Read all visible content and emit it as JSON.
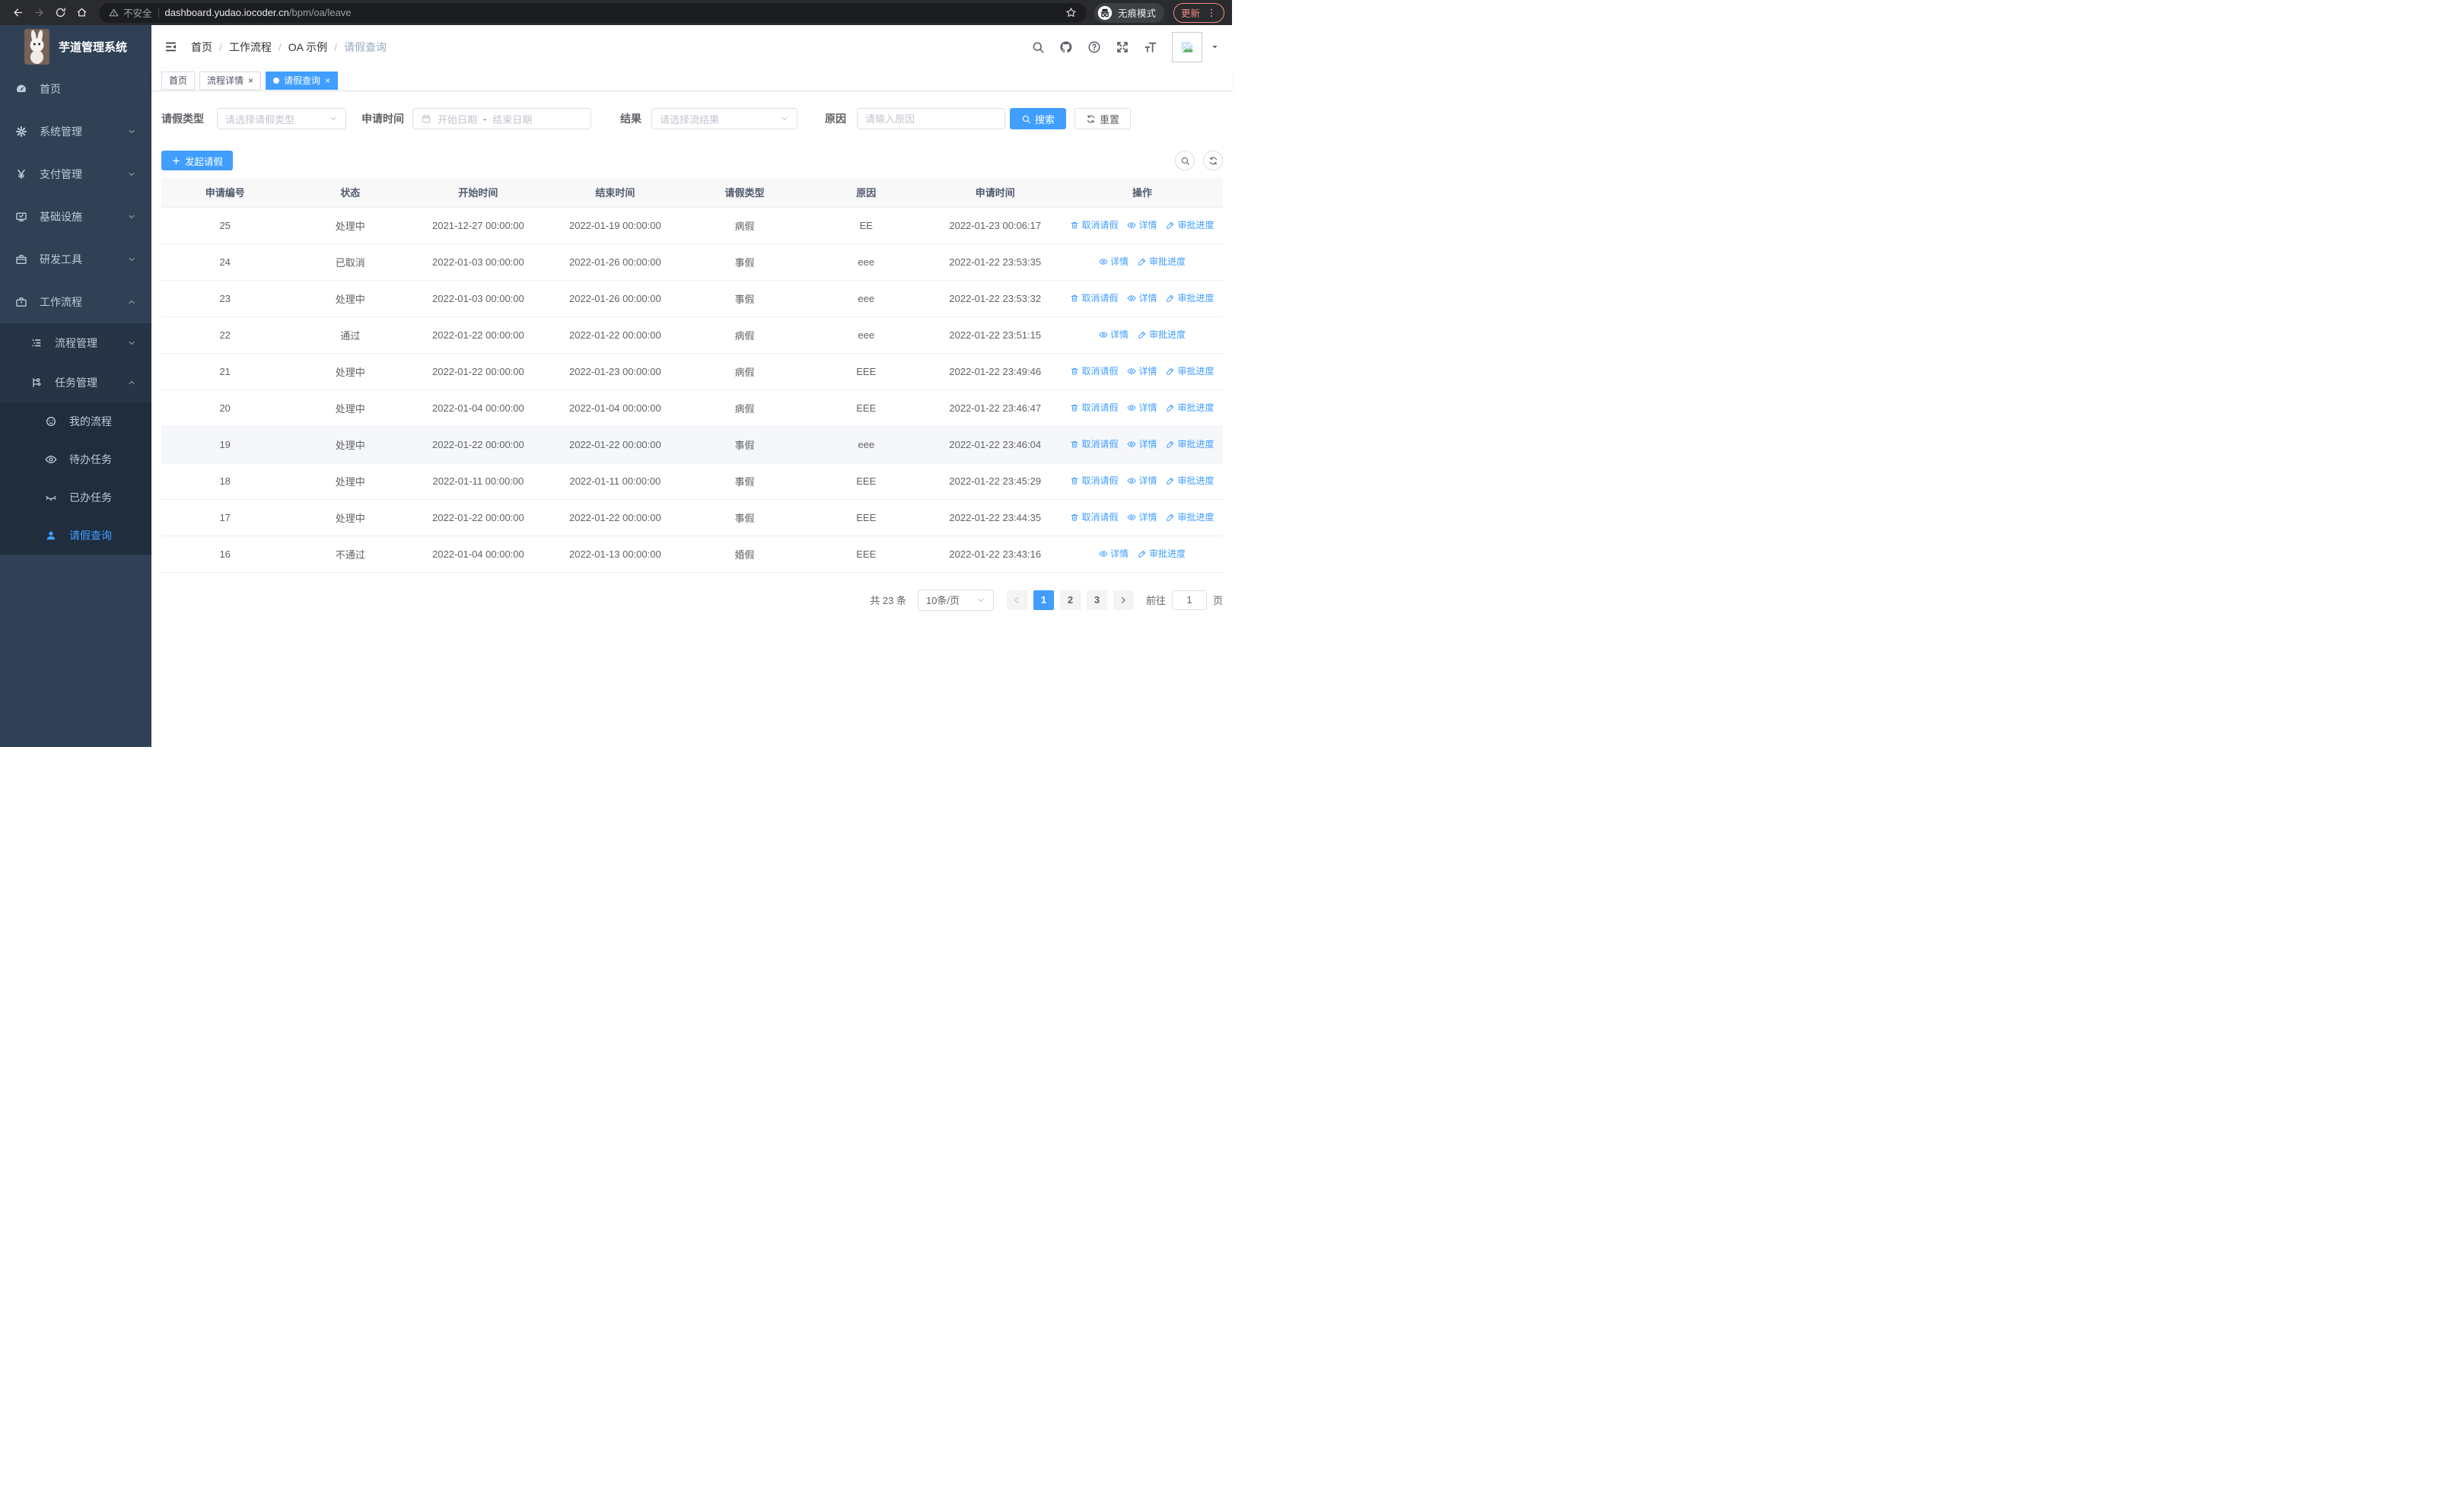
{
  "browser": {
    "security_label": "不安全",
    "url_host": "dashboard.yudao.iocoder.cn",
    "url_path": "/bpm/oa/leave",
    "incognito_label": "无痕模式",
    "update_label": "更新"
  },
  "sidebar": {
    "title": "芋道管理系统",
    "menu": [
      {
        "name": "home",
        "label": "首页",
        "icon": "dashboard-icon",
        "level": 1,
        "chevron": ""
      },
      {
        "name": "system",
        "label": "系统管理",
        "icon": "gear-icon",
        "level": 1,
        "chevron": "down"
      },
      {
        "name": "payment",
        "label": "支付管理",
        "icon": "yen-icon",
        "level": 1,
        "chevron": "down"
      },
      {
        "name": "infra",
        "label": "基础设施",
        "icon": "monitor-icon",
        "level": 1,
        "chevron": "down"
      },
      {
        "name": "dev-tools",
        "label": "研发工具",
        "icon": "toolbox-icon",
        "level": 1,
        "chevron": "down"
      },
      {
        "name": "workflow",
        "label": "工作流程",
        "icon": "briefcase-icon",
        "level": 1,
        "chevron": "up"
      },
      {
        "name": "process-mgmt",
        "label": "流程管理",
        "icon": "process-icon",
        "level": 2,
        "chevron": "down"
      },
      {
        "name": "task-mgmt",
        "label": "任务管理",
        "icon": "task-icon",
        "level": 2,
        "chevron": "up"
      },
      {
        "name": "my-process",
        "label": "我的流程",
        "icon": "face-icon",
        "level": 3,
        "chevron": ""
      },
      {
        "name": "todo-tasks",
        "label": "待办任务",
        "icon": "eye-open-icon",
        "level": 3,
        "chevron": ""
      },
      {
        "name": "done-tasks",
        "label": "已办任务",
        "icon": "eye-closed-icon",
        "level": 3,
        "chevron": ""
      },
      {
        "name": "leave-query",
        "label": "请假查询",
        "icon": "user-icon",
        "level": 3,
        "chevron": "",
        "active": true
      }
    ]
  },
  "header": {
    "breadcrumb": [
      "首页",
      "工作流程",
      "OA 示例",
      "请假查询"
    ]
  },
  "tabs": [
    {
      "label": "首页"
    },
    {
      "label": "流程详情",
      "closable": true
    },
    {
      "label": "请假查询",
      "closable": true,
      "active": true
    }
  ],
  "filters": {
    "leave_type_label": "请假类型",
    "leave_type_placeholder": "请选择请假类型",
    "apply_time_label": "申请时间",
    "start_date_placeholder": "开始日期",
    "range_separator": "-",
    "end_date_placeholder": "结束日期",
    "result_label": "结果",
    "result_placeholder": "请选择流结果",
    "reason_label": "原因",
    "reason_placeholder": "请输入原因",
    "search_label": "搜索",
    "reset_label": "重置"
  },
  "toolbar": {
    "create_label": "发起请假"
  },
  "table": {
    "columns": [
      "申请编号",
      "状态",
      "开始时间",
      "结束时间",
      "请假类型",
      "原因",
      "申请时间",
      "操作"
    ],
    "action_labels": {
      "cancel": "取消请假",
      "detail": "详情",
      "progress": "审批进度"
    },
    "rows": [
      {
        "id": "25",
        "status": "处理中",
        "start": "2021-12-27 00:00:00",
        "end": "2022-01-19 00:00:00",
        "type": "病假",
        "reason": "EE",
        "apply_time": "2022-01-23 00:06:17",
        "actions": [
          "cancel",
          "detail",
          "progress"
        ]
      },
      {
        "id": "24",
        "status": "已取消",
        "start": "2022-01-03 00:00:00",
        "end": "2022-01-26 00:00:00",
        "type": "事假",
        "reason": "eee",
        "apply_time": "2022-01-22 23:53:35",
        "actions": [
          "detail",
          "progress"
        ]
      },
      {
        "id": "23",
        "status": "处理中",
        "start": "2022-01-03 00:00:00",
        "end": "2022-01-26 00:00:00",
        "type": "事假",
        "reason": "eee",
        "apply_time": "2022-01-22 23:53:32",
        "actions": [
          "cancel",
          "detail",
          "progress"
        ]
      },
      {
        "id": "22",
        "status": "通过",
        "start": "2022-01-22 00:00:00",
        "end": "2022-01-22 00:00:00",
        "type": "病假",
        "reason": "eee",
        "apply_time": "2022-01-22 23:51:15",
        "actions": [
          "detail",
          "progress"
        ]
      },
      {
        "id": "21",
        "status": "处理中",
        "start": "2022-01-22 00:00:00",
        "end": "2022-01-23 00:00:00",
        "type": "病假",
        "reason": "EEE",
        "apply_time": "2022-01-22 23:49:46",
        "actions": [
          "cancel",
          "detail",
          "progress"
        ]
      },
      {
        "id": "20",
        "status": "处理中",
        "start": "2022-01-04 00:00:00",
        "end": "2022-01-04 00:00:00",
        "type": "病假",
        "reason": "EEE",
        "apply_time": "2022-01-22 23:46:47",
        "actions": [
          "cancel",
          "detail",
          "progress"
        ]
      },
      {
        "id": "19",
        "status": "处理中",
        "start": "2022-01-22 00:00:00",
        "end": "2022-01-22 00:00:00",
        "type": "事假",
        "reason": "eee",
        "apply_time": "2022-01-22 23:46:04",
        "actions": [
          "cancel",
          "detail",
          "progress"
        ],
        "highlighted": true
      },
      {
        "id": "18",
        "status": "处理中",
        "start": "2022-01-11 00:00:00",
        "end": "2022-01-11 00:00:00",
        "type": "事假",
        "reason": "EEE",
        "apply_time": "2022-01-22 23:45:29",
        "actions": [
          "cancel",
          "detail",
          "progress"
        ]
      },
      {
        "id": "17",
        "status": "处理中",
        "start": "2022-01-22 00:00:00",
        "end": "2022-01-22 00:00:00",
        "type": "事假",
        "reason": "EEE",
        "apply_time": "2022-01-22 23:44:35",
        "actions": [
          "cancel",
          "detail",
          "progress"
        ]
      },
      {
        "id": "16",
        "status": "不通过",
        "start": "2022-01-04 00:00:00",
        "end": "2022-01-13 00:00:00",
        "type": "婚假",
        "reason": "EEE",
        "apply_time": "2022-01-22 23:43:16",
        "actions": [
          "detail",
          "progress"
        ]
      }
    ]
  },
  "pagination": {
    "total_label": "共 23 条",
    "page_size_label": "10条/页",
    "pages": [
      "1",
      "2",
      "3"
    ],
    "active_page": "1",
    "goto_label": "前往",
    "goto_value": "1",
    "unit_label": "页"
  },
  "colors": {
    "accent": "#409eff",
    "sidebar_bg": "#304156",
    "submenu_bg": "#263445",
    "submenu_deep_bg": "#1f2d3d",
    "table_header_bg": "#f8f8f9",
    "table_border": "#ebeef5",
    "update_badge": "#f28b82"
  }
}
